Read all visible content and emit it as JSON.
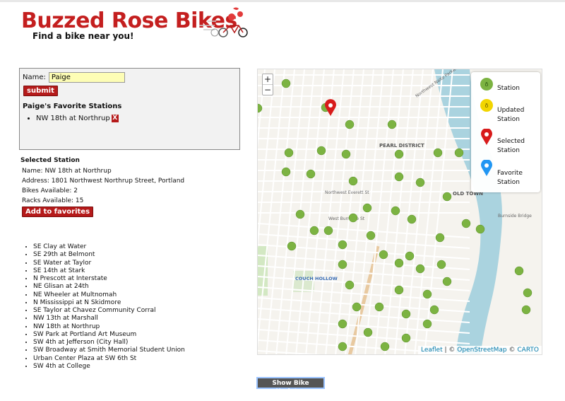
{
  "header": {
    "title": "Buzzed Rose Bikes",
    "tagline": "Find a bike near you!"
  },
  "form": {
    "name_label": "Name:",
    "name_value": "Paige",
    "submit_label": "submit",
    "favorites_title": "Paige's Favorite Stations",
    "favorites": [
      "NW 18th at Northrup"
    ],
    "remove_label": "X"
  },
  "selected": {
    "title": "Selected Station",
    "name": "Name: NW 18th at Northrup",
    "address": "Address: 1801 Northwest Northrup Street, Portland",
    "bikes": "Bikes Available: 2",
    "racks": "Racks Available: 15",
    "add_label": "Add to favorites"
  },
  "stations": [
    "SE Clay at Water",
    "SE 29th at Belmont",
    "SE Water at Taylor",
    "SE 14th at Stark",
    "N Prescott at Interstate",
    "NE Glisan at 24th",
    "NE Wheeler at Multnomah",
    "N Mississippi at N Skidmore",
    "SE Taylor at Chavez Community Corral",
    "NW 13th at Marshall",
    "NW 18th at Northrup",
    "SW Park at Portland Art Museum",
    "SW 4th at Jefferson (City Hall)",
    "SW Broadway at Smith Memorial Student Union",
    "Urban Center Plaza at SW 6th St",
    "SW 4th at College"
  ],
  "map": {
    "zoom_in": "+",
    "zoom_out": "−",
    "labels": {
      "pearl_district": "PEARL DISTRICT",
      "old_town": "OLD TOWN",
      "couch_hollow": "COUCH HOLLOW",
      "burnside": "West Burnside St",
      "everett": "Northwest Everett St",
      "burnside_bridge": "Burnside Bridge",
      "naito": "Northwest Naito Parkway"
    },
    "legend": {
      "station": "Station",
      "updated": "Updated Station",
      "selected": "Selected Station",
      "favorite": "Favorite Station"
    },
    "attribution": {
      "leaflet": "Leaflet",
      "sep": " | © ",
      "osm": "OpenStreetMap",
      "sep2": " © ",
      "carto": "CARTO"
    },
    "colors": {
      "station": "#7cb342",
      "updated": "#f2d500",
      "selected": "#d81b1b",
      "favorite": "#2196f3",
      "river": "#aad3df"
    }
  },
  "footer": {
    "updates_label": "Show Bike Updates"
  }
}
